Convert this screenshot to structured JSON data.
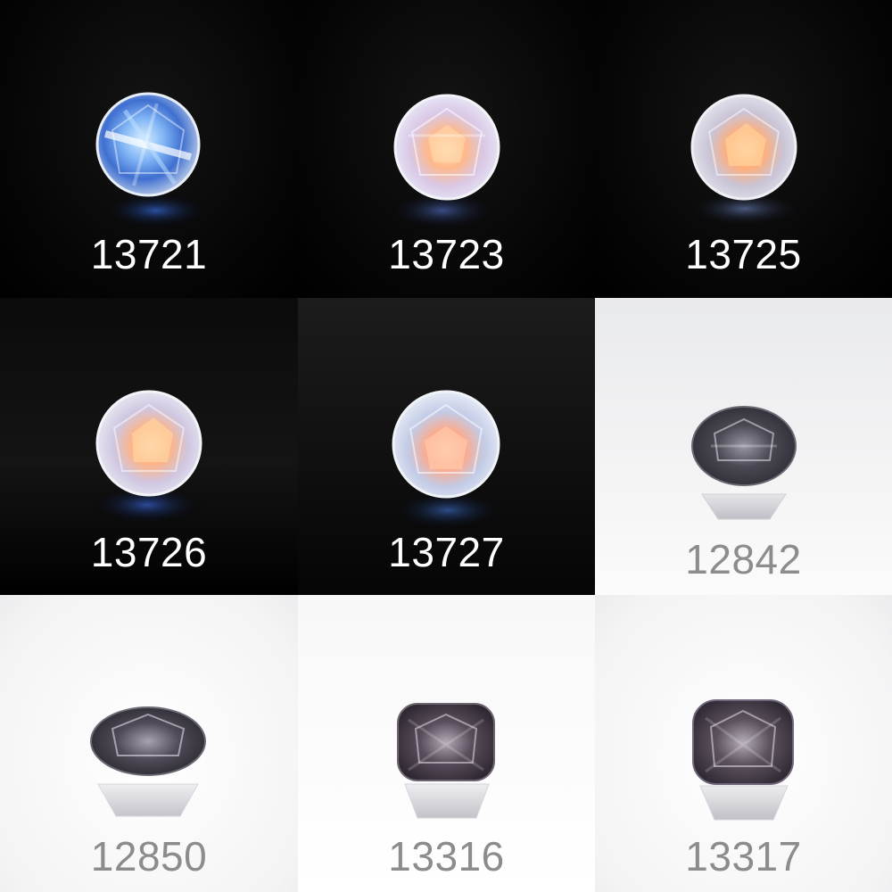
{
  "tiles": [
    {
      "label": "13721",
      "theme": "dark",
      "shape": "round",
      "glow": "blue"
    },
    {
      "label": "13723",
      "theme": "dark",
      "shape": "round",
      "glow": "peach"
    },
    {
      "label": "13725",
      "theme": "dark",
      "shape": "round",
      "glow": "peach"
    },
    {
      "label": "13726",
      "theme": "dark",
      "shape": "round",
      "glow": "peach"
    },
    {
      "label": "13727",
      "theme": "dark",
      "shape": "round",
      "glow": "peach"
    },
    {
      "label": "12842",
      "theme": "light",
      "shape": "oval",
      "glow": "gray"
    },
    {
      "label": "12850",
      "theme": "light",
      "shape": "oval",
      "glow": "gray"
    },
    {
      "label": "13316",
      "theme": "light",
      "shape": "cushion",
      "glow": "gray"
    },
    {
      "label": "13317",
      "theme": "light",
      "shape": "cushion",
      "glow": "gray"
    }
  ],
  "colors": {
    "dark_label": "#ffffff",
    "light_label": "#8c8c8c",
    "moonstone_blue": "#3f7fe0",
    "moonstone_peach": "#ffb889",
    "spinel_gray": "#3c3a44"
  }
}
